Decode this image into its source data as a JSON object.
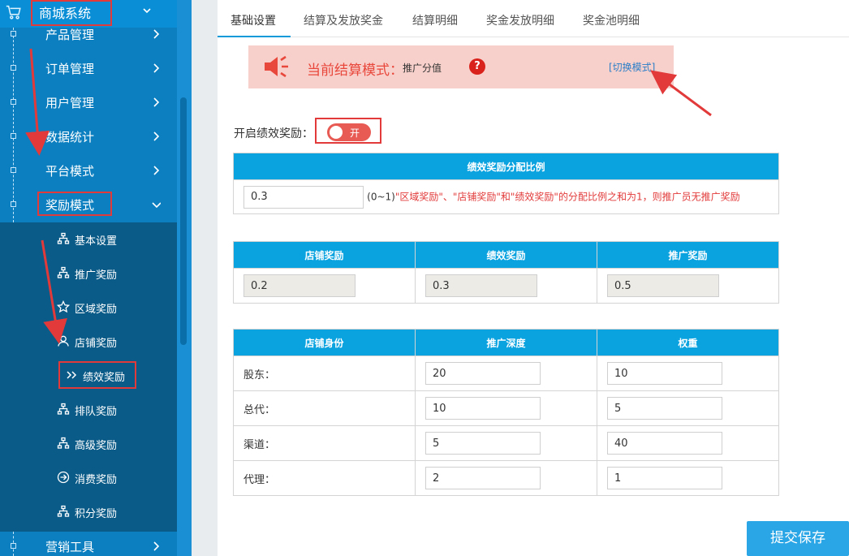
{
  "sidebar": {
    "system_title": "商城系统",
    "nav_items": [
      {
        "label": "产品管理"
      },
      {
        "label": "订单管理"
      },
      {
        "label": "用户管理"
      },
      {
        "label": "数据统计"
      },
      {
        "label": "平台模式"
      },
      {
        "label": "奖励模式"
      }
    ],
    "sub_items": [
      {
        "label": "基本设置",
        "icon": "sitemap-icon"
      },
      {
        "label": "推广奖励",
        "icon": "sitemap-icon"
      },
      {
        "label": "区域奖励",
        "icon": "star-icon"
      },
      {
        "label": "店铺奖励",
        "icon": "user-icon"
      },
      {
        "label": "绩效奖励",
        "icon": "double-chevron-icon"
      },
      {
        "label": "排队奖励",
        "icon": "sitemap-icon"
      },
      {
        "label": "高级奖励",
        "icon": "sitemap-icon"
      },
      {
        "label": "消费奖励",
        "icon": "circle-arrow-icon"
      },
      {
        "label": "积分奖励",
        "icon": "sitemap-icon"
      }
    ],
    "bottom_item": {
      "label": "营销工具"
    }
  },
  "tabs": [
    {
      "label": "基础设置",
      "active": true
    },
    {
      "label": "结算及发放奖金"
    },
    {
      "label": "结算明细"
    },
    {
      "label": "奖金发放明细"
    },
    {
      "label": "奖金池明细"
    }
  ],
  "notice": {
    "title": "当前结算模式：",
    "value": "推广分值",
    "help": "?",
    "switch_link": "[切换模式]"
  },
  "toggle": {
    "label": "开启绩效奖励：",
    "state_label": "开"
  },
  "ratio_table": {
    "header": "绩效奖励分配比例",
    "value": "0.3",
    "hint_prefix": "(0~1)",
    "hint_red": "\"区域奖励\"、\"店铺奖励\"和\"绩效奖励\"的分配比例之和为1，则推广员无推广奖励"
  },
  "split_table": {
    "headers": [
      "店铺奖励",
      "绩效奖励",
      "推广奖励"
    ],
    "values": [
      "0.2",
      "0.3",
      "0.5"
    ]
  },
  "rank_table": {
    "headers": [
      "店铺身份",
      "推广深度",
      "权重"
    ],
    "rows": [
      {
        "role": "股东：",
        "depth": "20",
        "weight": "10"
      },
      {
        "role": "总代：",
        "depth": "10",
        "weight": "5"
      },
      {
        "role": "渠道：",
        "depth": "5",
        "weight": "40"
      },
      {
        "role": "代理：",
        "depth": "2",
        "weight": "1"
      }
    ]
  },
  "submit_label": "提交保存",
  "colors": {
    "sidebar": "#0b7fc0",
    "submenu": "#0a5b88",
    "table_header": "#0aa3e0",
    "notice_bg": "#f8d0cb",
    "annotation_red": "#e23a3a"
  }
}
